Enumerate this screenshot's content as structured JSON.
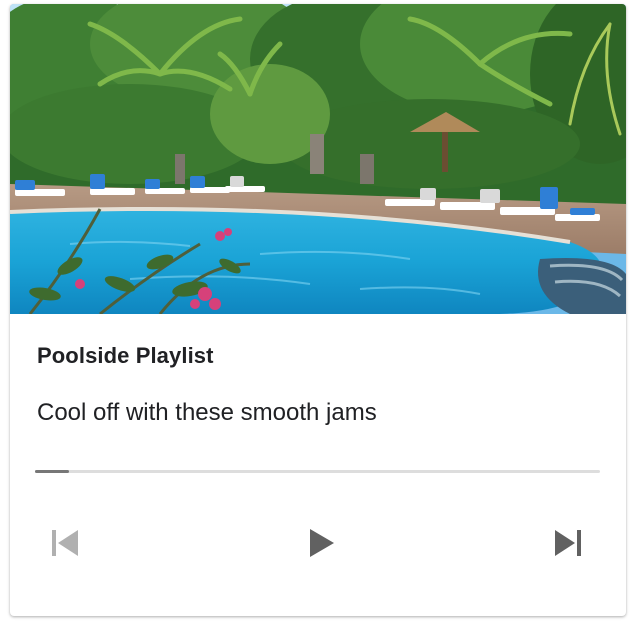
{
  "card": {
    "title": "Poolside Playlist",
    "subtitle": "Cool off with these smooth jams",
    "media_alt": "Resort swimming pool with lounge chairs and palm trees"
  },
  "player": {
    "progress_fraction": 0.06,
    "controls": {
      "previous_icon": "skip-previous-icon",
      "play_icon": "play-icon",
      "next_icon": "skip-next-icon",
      "previous_enabled": false,
      "next_enabled": true
    }
  },
  "colors": {
    "icon_enabled": "#616161",
    "icon_disabled": "#b0b0b0",
    "progress_fill": "#777777",
    "progress_track": "#dddddd"
  }
}
